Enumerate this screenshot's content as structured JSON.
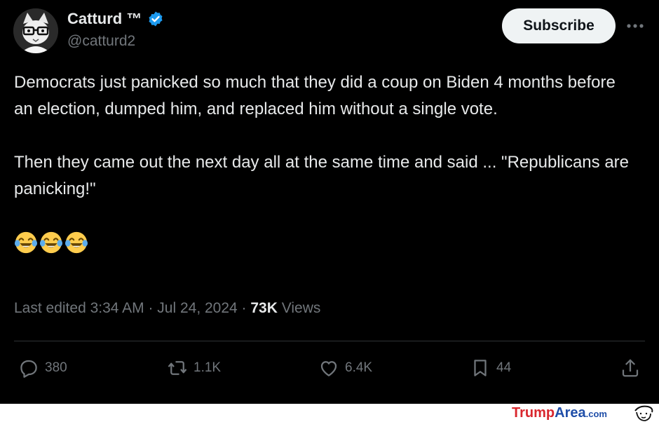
{
  "author": {
    "display_name": "Catturd ™",
    "handle": "@catturd2"
  },
  "header": {
    "subscribe_label": "Subscribe"
  },
  "post": {
    "paragraphs": [
      "Democrats just panicked so much that they did a coup on Biden 4 months before an election, dumped him, and replaced him without a single vote.",
      "Then they came out the next day all at the same time and said ... \"Republicans are panicking!\""
    ],
    "emoji": [
      "face-with-tears-of-joy",
      "face-with-tears-of-joy",
      "face-with-tears-of-joy"
    ]
  },
  "meta": {
    "edited_prefix": "Last edited 3:34 AM · Jul 24, 2024 · ",
    "views_count": "73K",
    "views_label": " Views"
  },
  "actions": {
    "replies": "380",
    "reposts": "1.1K",
    "likes": "6.4K",
    "bookmarks": "44"
  },
  "watermark": {
    "brand_red": "Trump",
    "brand_blue": "Area",
    "brand_suffix": ".com"
  },
  "colors": {
    "background": "#000000",
    "text_primary": "#e7e9ea",
    "text_secondary": "#71767b",
    "verified_blue": "#1d9bf0",
    "divider": "#2f3336"
  }
}
